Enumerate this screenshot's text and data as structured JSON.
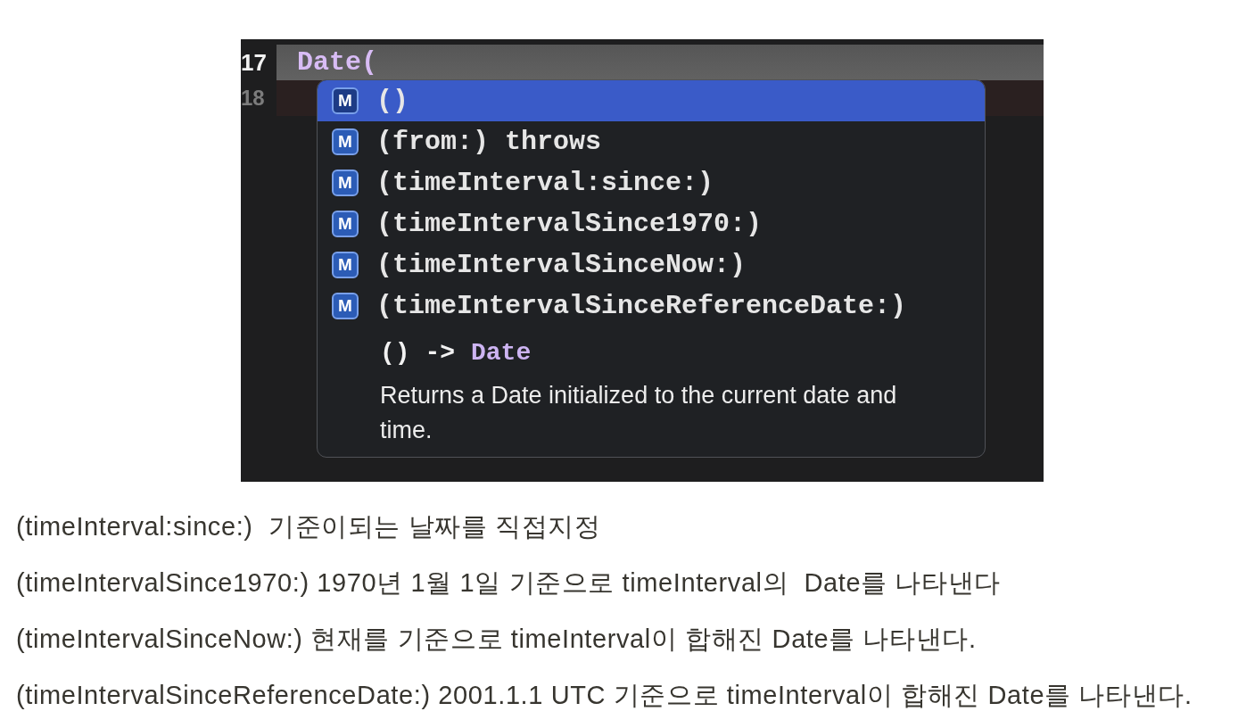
{
  "editor": {
    "lines": [
      {
        "number": "17",
        "code": "Date(",
        "current": true
      },
      {
        "number": "18",
        "current": false
      }
    ]
  },
  "completion_popup": {
    "items": [
      {
        "badge": "M",
        "label": "()",
        "selected": true
      },
      {
        "badge": "M",
        "label": "(from:) throws",
        "selected": false
      },
      {
        "badge": "M",
        "label": "(timeInterval:since:)",
        "selected": false
      },
      {
        "badge": "M",
        "label": "(timeIntervalSince1970:)",
        "selected": false
      },
      {
        "badge": "M",
        "label": "(timeIntervalSinceNow:)",
        "selected": false
      },
      {
        "badge": "M",
        "label": "(timeIntervalSinceReferenceDate:)",
        "selected": false
      }
    ],
    "signature": {
      "params": "() ->",
      "return_type": "Date"
    },
    "description": "Returns a Date initialized to the current date and time."
  },
  "notes": [
    "(timeInterval:since:)  기준이되는 날짜를 직접지정",
    "(timeIntervalSince1970:) 1970년 1월 1일 기준으로 timeInterval의  Date를 나타낸다",
    "(timeIntervalSinceNow:) 현재를 기준으로 timeInterval이 합해진 Date를 나타낸다.",
    "(timeIntervalSinceReferenceDate:) 2001.1.1 UTC 기준으로 timeInterval이 합해진 Date를 나타낸다."
  ]
}
